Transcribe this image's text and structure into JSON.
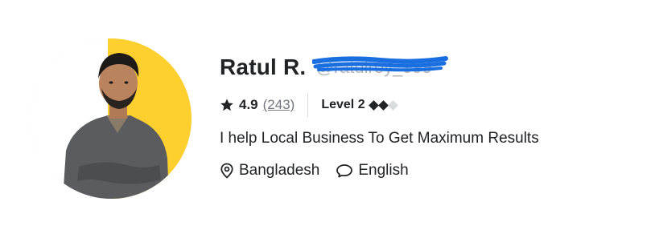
{
  "profile": {
    "name": "Ratul R.",
    "handle": "@ratulroy_999",
    "rating": "4.9",
    "review_count": "(243)",
    "level_label": "Level 2",
    "level_progress": {
      "filled": 2,
      "total": 3
    },
    "tagline": "I help Local Business To Get Maximum Results",
    "location": "Bangladesh",
    "language": "English"
  },
  "icons": {
    "star": "star-icon",
    "location": "location-pin-icon",
    "language": "chat-bubble-icon",
    "level": "diamond-icon"
  },
  "colors": {
    "avatar_accent": "#fdd02f",
    "scribble": "#1a6fe0",
    "text": "#222325",
    "muted": "#74767e"
  }
}
